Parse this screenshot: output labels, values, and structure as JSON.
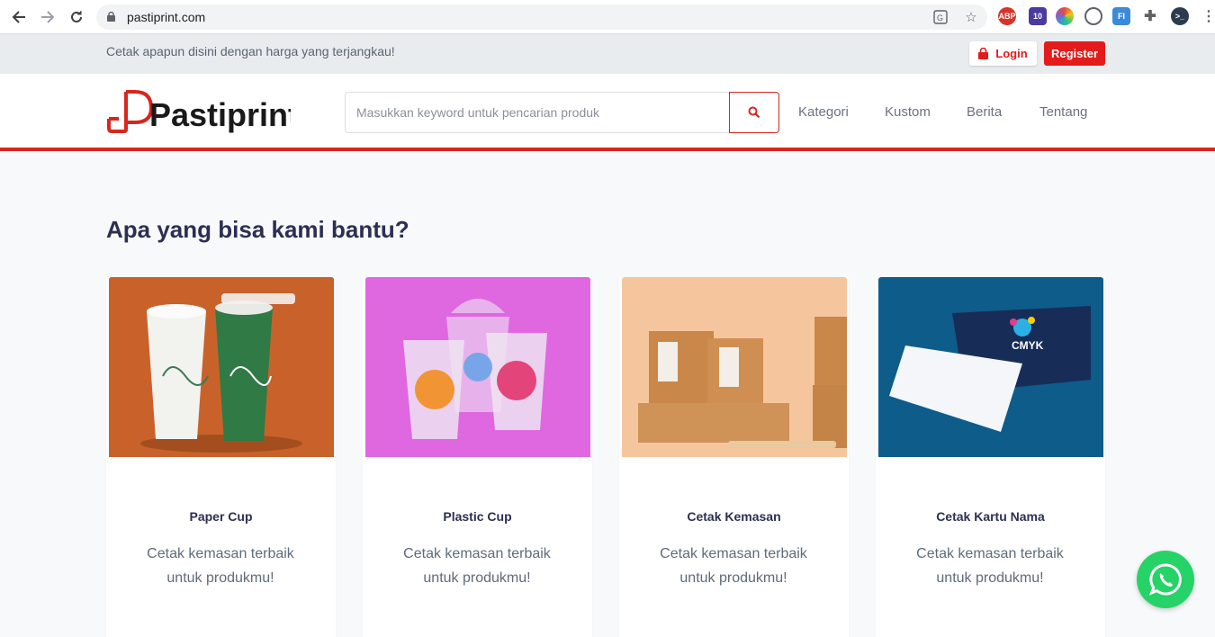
{
  "browser": {
    "url": "pastiprint.com",
    "extensions": [
      {
        "name": "abp",
        "label": "ABP",
        "color": "#d8342a"
      },
      {
        "name": "badge",
        "label": "10",
        "color": "#4c3aa0"
      },
      {
        "name": "color-wheel",
        "label": "",
        "color": "#e8a400"
      },
      {
        "name": "globe",
        "label": "",
        "color": "#5f6368"
      },
      {
        "name": "fi",
        "label": "FI",
        "color": "#3b8bd6"
      },
      {
        "name": "puzzle",
        "label": "",
        "color": "#5f6368"
      },
      {
        "name": "terminal",
        "label": "",
        "color": "#2d3b4e"
      }
    ]
  },
  "topbar": {
    "tagline": "Cetak apapun disini dengan harga yang terjangkau!",
    "login": "Login",
    "register": "Register"
  },
  "header": {
    "logo_text": "Pastiprint",
    "search_placeholder": "Masukkan keyword untuk pencarian produk",
    "menu": [
      "Kategori",
      "Kustom",
      "Berita",
      "Tentang"
    ]
  },
  "main": {
    "title": "Apa yang bisa kami bantu?",
    "cards": [
      {
        "title": "Paper Cup",
        "desc": "Cetak kemasan terbaik untuk produkmu!"
      },
      {
        "title": "Plastic Cup",
        "desc": "Cetak kemasan terbaik untuk produkmu!"
      },
      {
        "title": "Cetak Kemasan",
        "desc": "Cetak kemasan terbaik untuk produkmu!"
      },
      {
        "title": "Cetak Kartu Nama",
        "desc": "Cetak kemasan terbaik untuk produkmu!"
      }
    ]
  },
  "colors": {
    "brand_red": "#e41b1b",
    "whatsapp": "#25d366"
  }
}
